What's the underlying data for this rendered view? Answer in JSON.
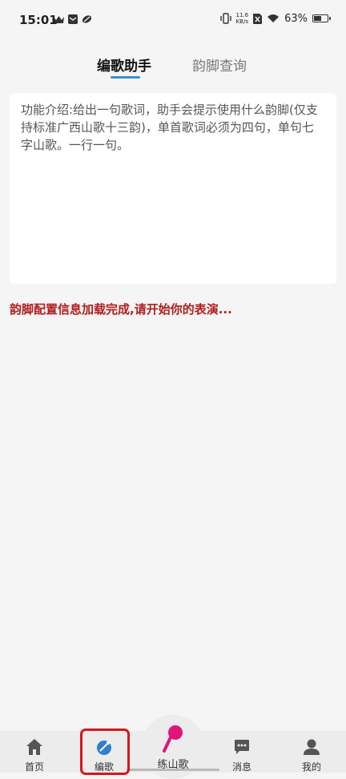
{
  "status_bar": {
    "time": "15:01",
    "net_speed_value": "11.6",
    "net_speed_unit": "KB/s",
    "battery_percent": "63%",
    "battery_level": 0.63
  },
  "tabs": [
    {
      "label": "编歌助手",
      "active": true
    },
    {
      "label": "韵脚查询",
      "active": false
    }
  ],
  "editor": {
    "placeholder": "功能介绍:给出一句歌词，助手会提示使用什么韵脚(仅支持标准广西山歌十三韵)，单首歌词必须为四句，单句七字山歌。一行一句。",
    "value": ""
  },
  "status_message": "韵脚配置信息加载完成,请开始你的表演...",
  "bottom_nav": {
    "home": "首页",
    "compose": "编歌",
    "practice": "练山歌",
    "messages": "消息",
    "profile": "我的"
  },
  "colors": {
    "accent": "#3a8fd1",
    "status_message": "#b01e1e",
    "practice_icon": "#e0157a",
    "highlight": "#d8161c"
  }
}
